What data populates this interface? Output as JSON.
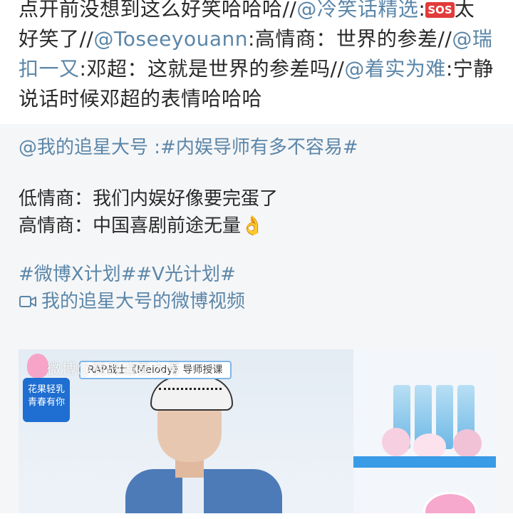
{
  "repost": {
    "seg1": "点开前没想到这么好笑哈哈哈//",
    "mention1": "@冷笑话精选",
    "seg2": ":",
    "sos": "SOS",
    "seg3": "太好笑了//",
    "mention2": "@Toseeyouann",
    "seg4": ":高情商：世界的参差//",
    "mention3": "@瑞扣一又",
    "seg5": ":邓超：这就是世界的参差吗//",
    "mention4": "@着实为难",
    "seg6": ":宁静说话时候邓超的表情哈哈哈"
  },
  "original": {
    "author": "@我的追星大号",
    "author_sep": " :",
    "topic": "#内娱导师有多不容易#",
    "line1": "低情商：我们内娱好像要完蛋了",
    "line2": "高情商：中国喜剧前途无量👌",
    "tags": "#微博X计划##V光计划#",
    "video_link": "我的追星大号的微博视频"
  },
  "video": {
    "watermark": "微博@我的追星大号",
    "caption": "RAP战士《Melody》导师授课",
    "logo_line1": "花果轻乳",
    "logo_line2": "青春有你"
  },
  "colors": {
    "link": "#5b86a8",
    "sos_bg": "#e23b3b",
    "card_bg": "#f5f6f8"
  },
  "icons": {
    "video": "video-camera-icon",
    "sos": "sos-emoji"
  }
}
